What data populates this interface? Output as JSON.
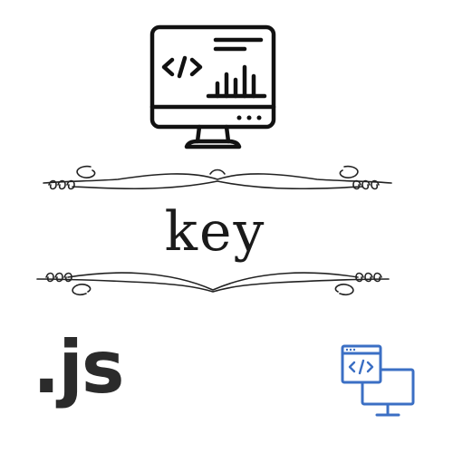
{
  "main": {
    "word": "key",
    "logo_text": ".js"
  },
  "icons": {
    "monitor": "monitor-code-chart-icon",
    "flourish": "ornamental-divider",
    "webdev": "window-code-monitor-icon"
  },
  "colors": {
    "ink": "#111111",
    "text": "#1a1a1a",
    "logo": "#2b2b2b",
    "accent_blue": "#3b6fc4"
  }
}
